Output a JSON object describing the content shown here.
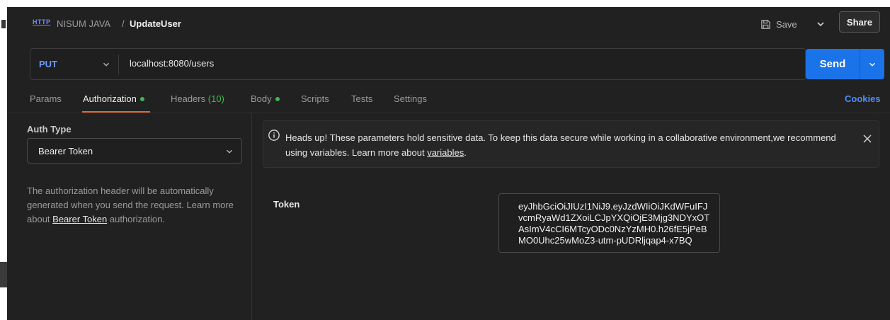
{
  "header": {
    "icon": "http-icon",
    "icon_text": "HTTP",
    "collection": "NISUM JAVA",
    "separator": "/",
    "request_name": "UpdateUser",
    "save_label": "Save",
    "share_label": "Share"
  },
  "request": {
    "method": "PUT",
    "url": "localhost:8080/users",
    "send_label": "Send"
  },
  "tabs": [
    {
      "label": "Params"
    },
    {
      "label": "Authorization"
    },
    {
      "label": "Headers",
      "count": "(10)"
    },
    {
      "label": "Body"
    },
    {
      "label": "Scripts"
    },
    {
      "label": "Tests"
    },
    {
      "label": "Settings"
    }
  ],
  "cookies_label": "Cookies",
  "auth": {
    "type_label": "Auth Type",
    "selected_type": "Bearer Token",
    "desc_pre": "The authorization header will be automatically generated when you send the request. Learn more about ",
    "desc_link": "Bearer Token",
    "desc_post": " authorization."
  },
  "notice": {
    "text_pre": "Heads up! These parameters hold sensitive data. To keep this data secure while working in a collaborative environment,we recommend using variables. Learn more about ",
    "link": "variables",
    "text_post": "."
  },
  "token": {
    "label": "Token",
    "lines": [
      "eyJhbGciOiJIUzI1NiJ9.eyJzdWIiOiJKdWFuIFJ",
      "vcmRyaWd1ZXoiLCJpYXQiOjE3Mjg3NDYxOT",
      "AsImV4cCI6MTcyODc0NzYzMH0.h26fE5jPeB",
      "MO0Uhc25wMoZ3-utm-pUDRljqap4-x7BQ"
    ]
  },
  "colors": {
    "accent": "#1a73e8",
    "method": "#6b9bff",
    "active_tab_underline": "#e0673a",
    "indicator": "#3fb950",
    "background": "#212121"
  }
}
